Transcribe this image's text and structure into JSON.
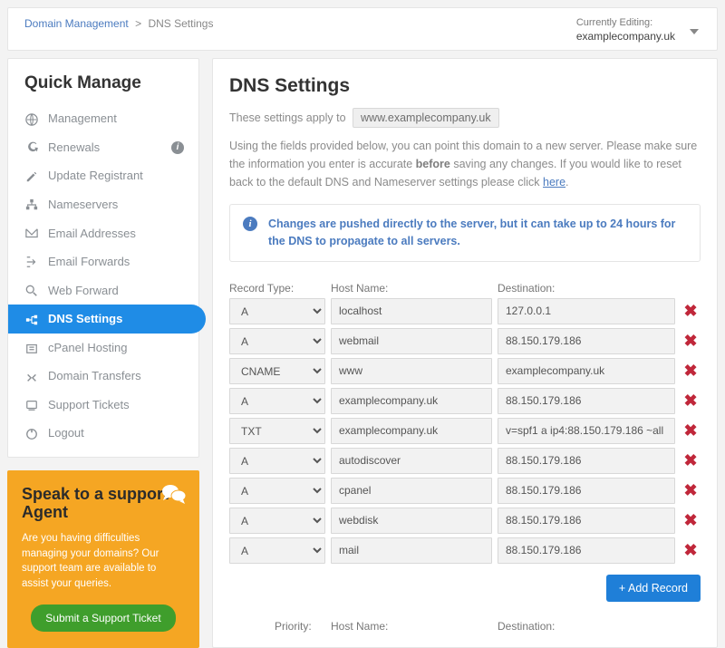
{
  "breadcrumb": {
    "root": "Domain Management",
    "current": "DNS Settings"
  },
  "currentlyEditing": {
    "label": "Currently Editing:",
    "value": "examplecompany.uk"
  },
  "sidebar": {
    "title": "Quick Manage",
    "items": [
      {
        "label": "Management"
      },
      {
        "label": "Renewals",
        "info": true
      },
      {
        "label": "Update Registrant"
      },
      {
        "label": "Nameservers"
      },
      {
        "label": "Email Addresses"
      },
      {
        "label": "Email Forwards"
      },
      {
        "label": "Web Forward"
      },
      {
        "label": "DNS Settings",
        "active": true
      },
      {
        "label": "cPanel Hosting"
      },
      {
        "label": "Domain Transfers"
      },
      {
        "label": "Support Tickets"
      },
      {
        "label": "Logout"
      }
    ]
  },
  "support": {
    "title": "Speak to a support Agent",
    "body": "Are you having difficulties managing your domains? Our support team are available to assist your queries.",
    "button": "Submit a Support Ticket"
  },
  "main": {
    "heading": "DNS Settings",
    "applies_prefix": "These settings apply to",
    "applies_domain": "www.examplecompany.uk",
    "desc_a": "Using the fields provided below, you can point this domain to a new server. Please make sure the information you enter is accurate ",
    "desc_bold": "before",
    "desc_b": " saving any changes. If you would like to reset back to the default DNS and Nameserver settings please click ",
    "desc_link": "here",
    "alert": "Changes are pushed directly to the server, but it can take up to 24 hours for the DNS to propagate to all servers.",
    "cols": {
      "type": "Record Type:",
      "host": "Host Name:",
      "dest": "Destination:"
    },
    "records": [
      {
        "type": "A",
        "host": "localhost",
        "dest": "127.0.0.1"
      },
      {
        "type": "A",
        "host": "webmail",
        "dest": "88.150.179.186"
      },
      {
        "type": "CNAME",
        "host": "www",
        "dest": "examplecompany.uk"
      },
      {
        "type": "A",
        "host": "examplecompany.uk",
        "dest": "88.150.179.186"
      },
      {
        "type": "TXT",
        "host": "examplecompany.uk",
        "dest": "v=spf1 a ip4:88.150.179.186 ~all"
      },
      {
        "type": "A",
        "host": "autodiscover",
        "dest": "88.150.179.186"
      },
      {
        "type": "A",
        "host": "cpanel",
        "dest": "88.150.179.186"
      },
      {
        "type": "A",
        "host": "webdisk",
        "dest": "88.150.179.186"
      },
      {
        "type": "A",
        "host": "mail",
        "dest": "88.150.179.186"
      }
    ],
    "add_button": "+ Add Record",
    "cols2": {
      "priority": "Priority:",
      "host": "Host Name:",
      "dest": "Destination:"
    }
  }
}
